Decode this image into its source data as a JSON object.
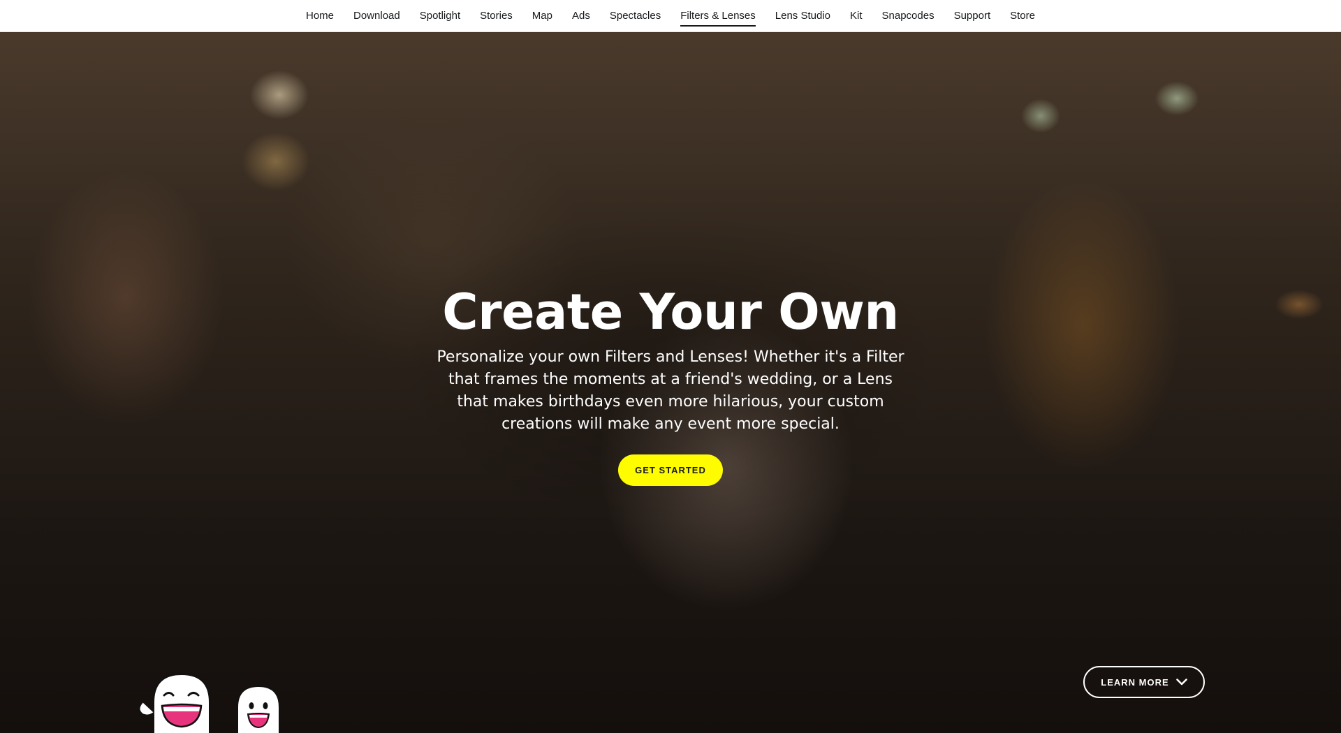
{
  "nav": {
    "items": [
      {
        "label": "Home"
      },
      {
        "label": "Download"
      },
      {
        "label": "Spotlight"
      },
      {
        "label": "Stories"
      },
      {
        "label": "Map"
      },
      {
        "label": "Ads"
      },
      {
        "label": "Spectacles"
      },
      {
        "label": "Filters & Lenses",
        "active": true
      },
      {
        "label": "Lens Studio"
      },
      {
        "label": "Kit"
      },
      {
        "label": "Snapcodes"
      },
      {
        "label": "Support"
      },
      {
        "label": "Store"
      }
    ]
  },
  "hero": {
    "title": "Create Your Own",
    "subtitle": "Personalize your own Filters and Lenses! Whether it's a Filter that frames the moments at a friend's wedding, or a Lens that makes birthdays even more hilarious, your custom creations will make any event more special.",
    "cta_label": "GET STARTED",
    "learn_more_label": "LEARN MORE",
    "learn_more_icon": "chevron-down-icon",
    "mascot_icon": "ghost-mascot-icon"
  },
  "colors": {
    "accent": "#fffc00",
    "nav_text": "#16191c",
    "hero_text": "#ffffff"
  }
}
